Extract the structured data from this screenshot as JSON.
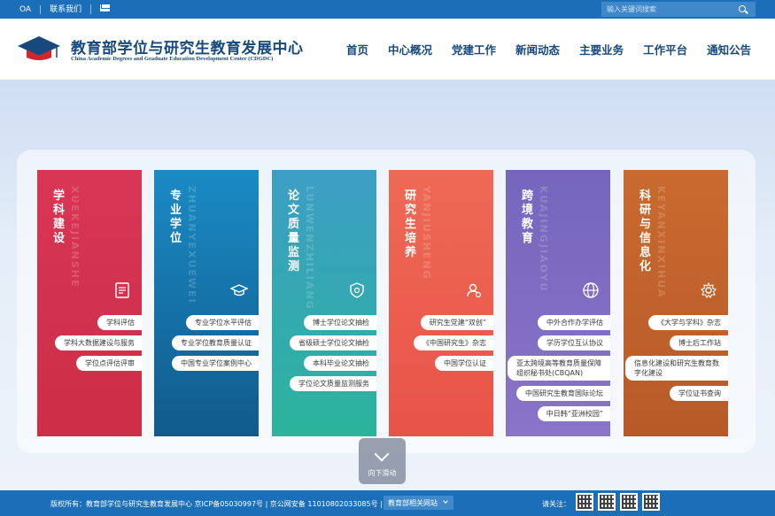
{
  "topbar": {
    "links": [
      "OA",
      "联系我们"
    ],
    "search_placeholder": "输入关键词搜索"
  },
  "header": {
    "logo_cn": "教育部学位与研究生教育发展中心",
    "logo_en": "China Academic Degrees and Graduate Education Development Center (CDGDC)",
    "nav": [
      "首页",
      "中心概况",
      "党建工作",
      "新闻动态",
      "主要业务",
      "工作平台",
      "通知公告"
    ]
  },
  "cards": [
    {
      "title": "学科建设",
      "pinyin": "XUEKEJIANSHE",
      "icon": "document-icon",
      "items": [
        "学科评估",
        "学科大数据建设与服务",
        "学位点评估评审"
      ]
    },
    {
      "title": "专业学位",
      "pinyin": "ZHUANYEXUEWEI",
      "icon": "graduation-cap-icon",
      "items": [
        "专业学位水平评估",
        "专业学位教育质量认证",
        "中国专业学位案例中心"
      ]
    },
    {
      "title": "论文质量监测",
      "pinyin": "LUNWENZHILIANG",
      "icon": "shield-icon",
      "items": [
        "博士学位论文抽检",
        "省级硕士学位论文抽检",
        "本科毕业论文抽检",
        "学位论文质量监测服务"
      ]
    },
    {
      "title": "研究生培养",
      "pinyin": "YANJIUSHENG",
      "icon": "user-icon",
      "items": [
        "研究生党建“双创”",
        "《中国研究生》杂志",
        "中国学位认证"
      ]
    },
    {
      "title": "跨境教育",
      "pinyin": "KUAJINGJIAOYU",
      "icon": "globe-icon",
      "items": [
        "中外合作办学评估",
        "学历学位互认协议",
        "亚太跨境高等教育质量保障组织秘书处(CBQAN)",
        "中国研究生教育国际论坛",
        "中日韩“亚洲校园”"
      ]
    },
    {
      "title": "科研与信息化",
      "pinyin": "KEYANXINXIHUA",
      "icon": "gear-icon",
      "items": [
        "《大学与学科》杂志",
        "博士后工作站",
        "信息化建设和研究生教育数字化建设",
        "学位证书查询"
      ]
    }
  ],
  "scroll_label": "向下滑动",
  "footer": {
    "copyright": "版权所有：教育部学位与研究生教育发展中心 京ICP备05030997号 | 京公网安备 11010802033085号 |",
    "select_label": "教育部相关网站",
    "follow_label": "请关注："
  }
}
